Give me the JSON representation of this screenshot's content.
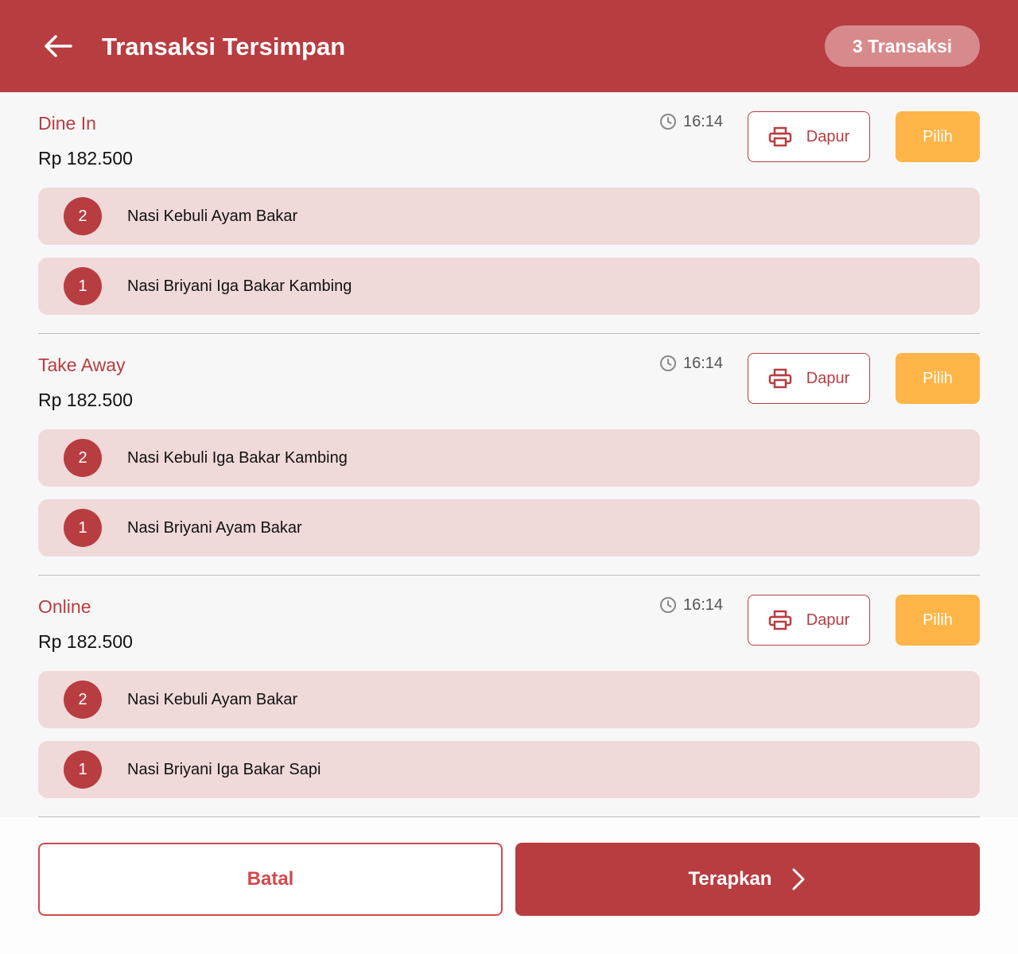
{
  "header": {
    "title": "Transaksi Tersimpan",
    "count_badge": "3 Transaksi"
  },
  "icons": {
    "back": "arrow-left-icon",
    "time": "clock-icon",
    "print": "printer-icon",
    "next": "chevron-right-icon"
  },
  "colors": {
    "primary": "#b83d41",
    "accent": "#ffb547",
    "item_bg": "#f0d9d9"
  },
  "transactions": [
    {
      "type": "Dine In",
      "total": "Rp 182.500",
      "time": "16:14",
      "dapur_label": "Dapur",
      "pilih_label": "Pilih",
      "items": [
        {
          "qty": "2",
          "name": "Nasi Kebuli Ayam Bakar"
        },
        {
          "qty": "1",
          "name": "Nasi Briyani Iga Bakar Kambing"
        }
      ]
    },
    {
      "type": "Take Away",
      "total": "Rp 182.500",
      "time": "16:14",
      "dapur_label": "Dapur",
      "pilih_label": "Pilih",
      "items": [
        {
          "qty": "2",
          "name": "Nasi Kebuli Iga Bakar Kambing"
        },
        {
          "qty": "1",
          "name": "Nasi Briyani Ayam Bakar"
        }
      ]
    },
    {
      "type": "Online",
      "total": "Rp 182.500",
      "time": "16:14",
      "dapur_label": "Dapur",
      "pilih_label": "Pilih",
      "items": [
        {
          "qty": "2",
          "name": "Nasi Kebuli Ayam Bakar"
        },
        {
          "qty": "1",
          "name": "Nasi Briyani Iga Bakar Sapi"
        }
      ]
    }
  ],
  "footer": {
    "cancel_label": "Batal",
    "apply_label": "Terapkan"
  }
}
